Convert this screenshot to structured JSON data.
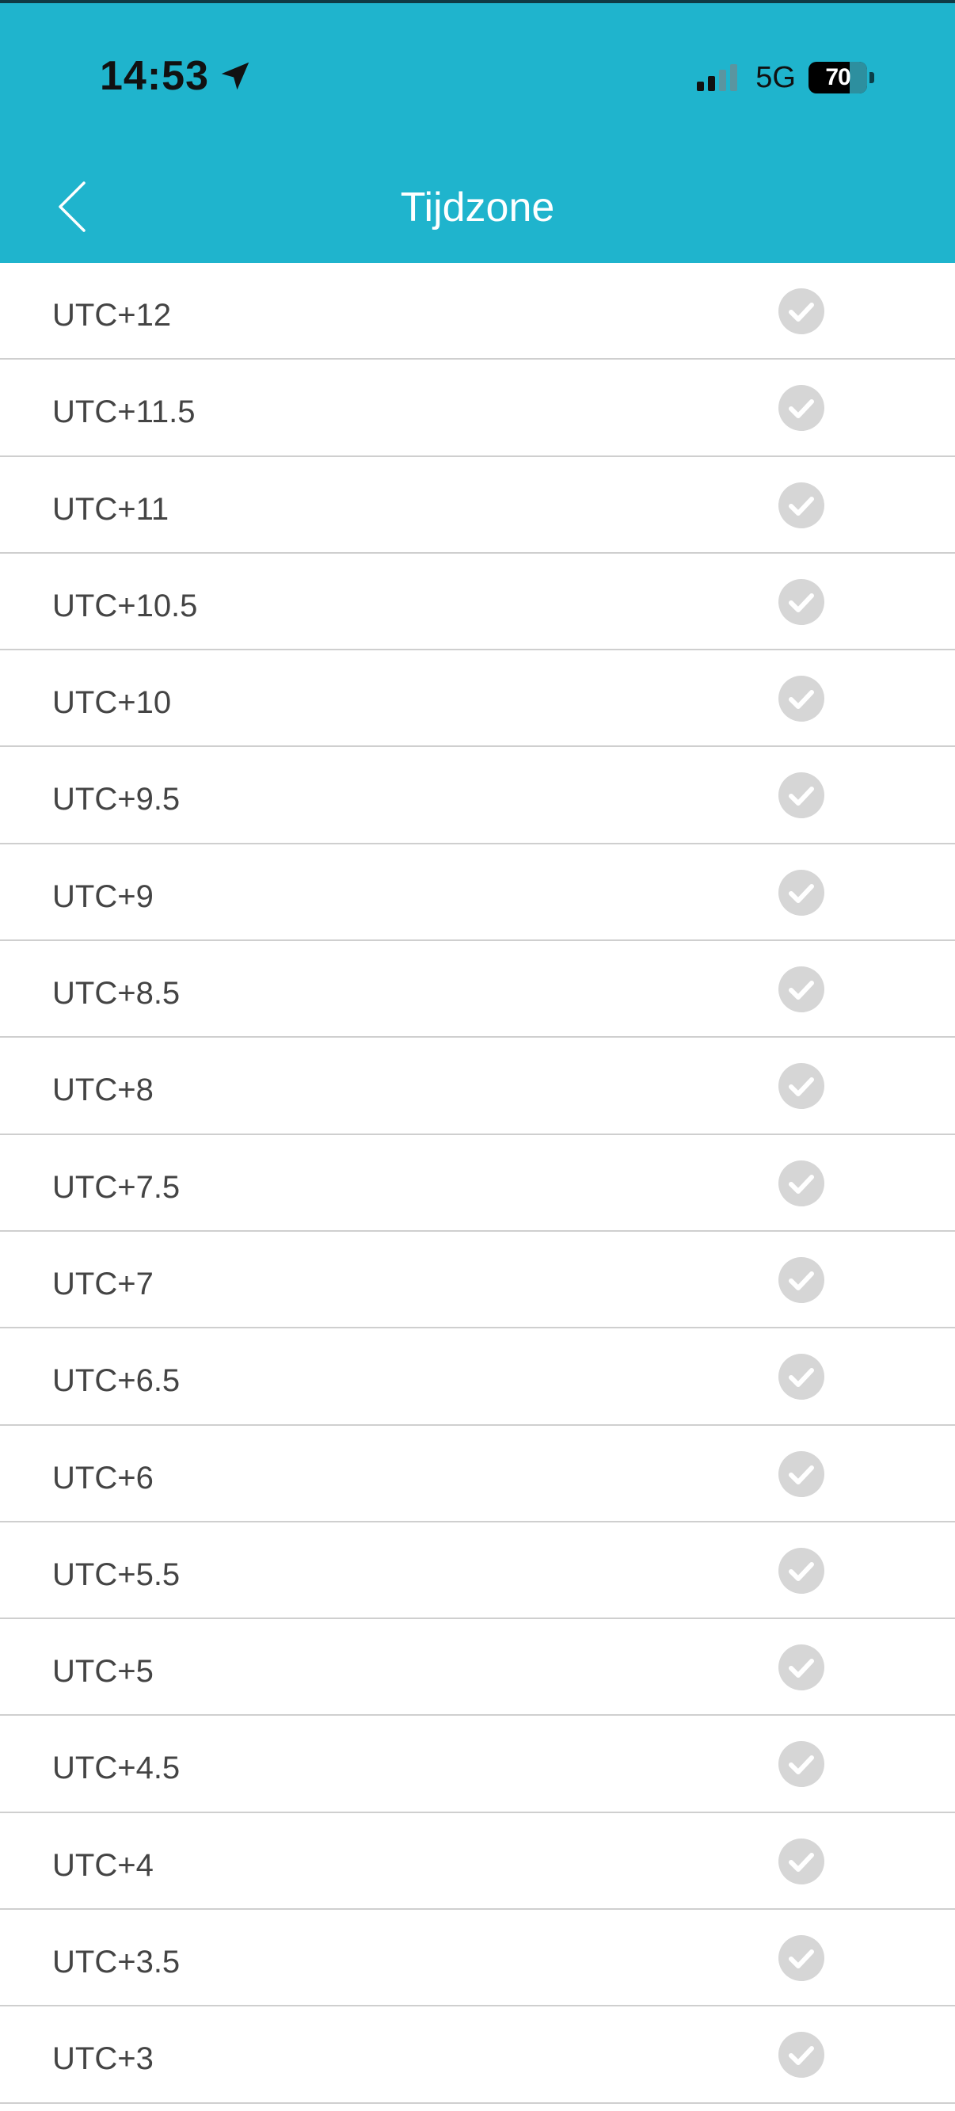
{
  "status_bar": {
    "time": "14:53",
    "location_icon": "location-arrow-icon",
    "signal_icon": "cellular-signal-icon",
    "network": "5G",
    "battery_percent": "70",
    "battery_level": 0.7
  },
  "header": {
    "back_icon": "chevron-left-icon",
    "title": "Tijdzone"
  },
  "colors": {
    "header_bg": "#1fb4cd",
    "check_gray": "#d6d6d6",
    "divider": "#cfcfcf",
    "label_text": "#444444"
  },
  "timezones": [
    {
      "label": "UTC+12",
      "selected": false
    },
    {
      "label": "UTC+11.5",
      "selected": false
    },
    {
      "label": "UTC+11",
      "selected": false
    },
    {
      "label": "UTC+10.5",
      "selected": false
    },
    {
      "label": "UTC+10",
      "selected": false
    },
    {
      "label": "UTC+9.5",
      "selected": false
    },
    {
      "label": "UTC+9",
      "selected": false
    },
    {
      "label": "UTC+8.5",
      "selected": false
    },
    {
      "label": "UTC+8",
      "selected": false
    },
    {
      "label": "UTC+7.5",
      "selected": false
    },
    {
      "label": "UTC+7",
      "selected": false
    },
    {
      "label": "UTC+6.5",
      "selected": false
    },
    {
      "label": "UTC+6",
      "selected": false
    },
    {
      "label": "UTC+5.5",
      "selected": false
    },
    {
      "label": "UTC+5",
      "selected": false
    },
    {
      "label": "UTC+4.5",
      "selected": false
    },
    {
      "label": "UTC+4",
      "selected": false
    },
    {
      "label": "UTC+3.5",
      "selected": false
    },
    {
      "label": "UTC+3",
      "selected": false
    }
  ]
}
